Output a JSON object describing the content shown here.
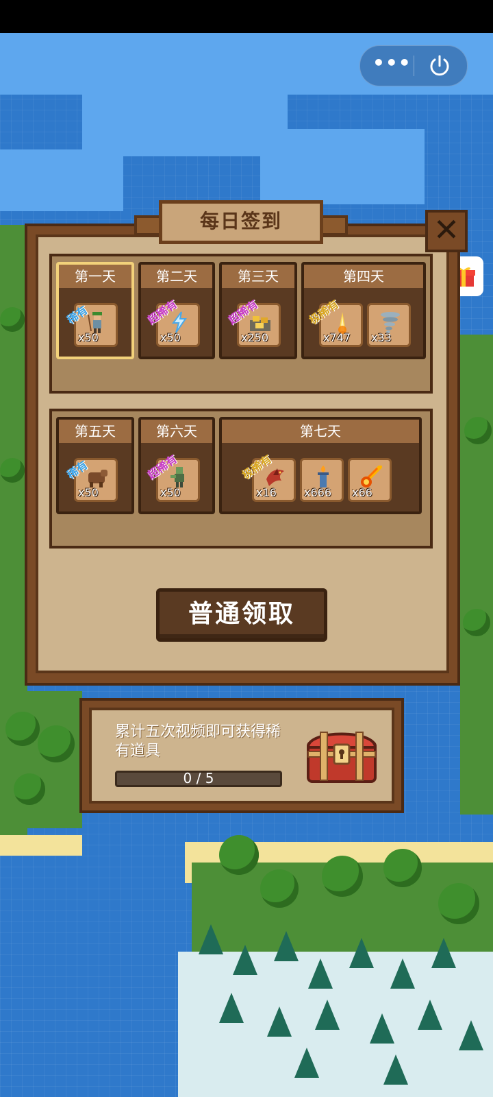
{
  "header": {
    "more_label": "•••",
    "power_icon": "power-icon"
  },
  "popup": {
    "title": "每日签到",
    "close_label": "✕",
    "claim_label": "普通领取"
  },
  "days": [
    {
      "label": "第一天",
      "rewards": [
        {
          "rarity": "稀有",
          "qty": "x50",
          "icon": "archer-icon"
        }
      ]
    },
    {
      "label": "第二天",
      "rewards": [
        {
          "rarity": "超稀有",
          "qty": "x50",
          "icon": "lightning-icon"
        }
      ]
    },
    {
      "label": "第三天",
      "rewards": [
        {
          "rarity": "超稀有",
          "qty": "x250",
          "icon": "gold-ore-icon"
        }
      ]
    },
    {
      "label": "第四天",
      "rewards": [
        {
          "rarity": "极稀有",
          "qty": "x747",
          "icon": "fire-beam-icon"
        },
        {
          "rarity": "",
          "qty": "x33",
          "icon": "tornado-icon"
        }
      ]
    },
    {
      "label": "第五天",
      "rewards": [
        {
          "rarity": "稀有",
          "qty": "x50",
          "icon": "bear-icon"
        }
      ]
    },
    {
      "label": "第六天",
      "rewards": [
        {
          "rarity": "超稀有",
          "qty": "x50",
          "icon": "zombie-icon"
        }
      ]
    },
    {
      "label": "第七天",
      "rewards": [
        {
          "rarity": "极稀有",
          "qty": "x16",
          "icon": "red-dragon-icon"
        },
        {
          "rarity": "",
          "qty": "x666",
          "icon": "torch-tower-icon"
        },
        {
          "rarity": "",
          "qty": "x66",
          "icon": "meteor-icon"
        }
      ]
    }
  ],
  "video": {
    "text": "累计五次视频即可获得稀有道具",
    "progress_label": "0 / 5",
    "progress": 0
  },
  "colors": {
    "rare": "#3aa2e8",
    "super_rare": "#c63ac6",
    "ultra_rare": "#d8a620",
    "panel": "#cdb48e",
    "frame": "#7a4a26"
  }
}
